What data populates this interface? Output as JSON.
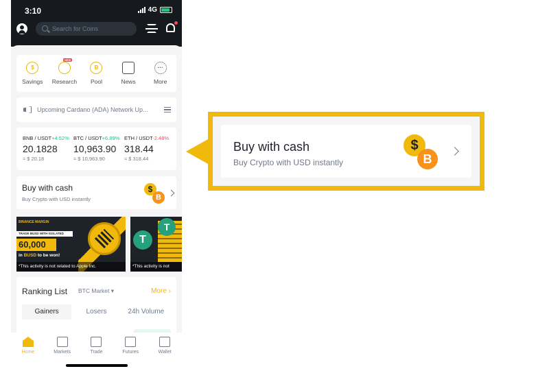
{
  "status_bar": {
    "time": "3:10",
    "network": "4G"
  },
  "header": {
    "search_placeholder": "Search for Coins"
  },
  "quick_actions": [
    {
      "label": "Savings",
      "icon": "savings-icon",
      "glyph": "$"
    },
    {
      "label": "Research",
      "icon": "research-icon",
      "glyph": "",
      "badge": "NEW"
    },
    {
      "label": "Pool",
      "icon": "pool-icon",
      "glyph": "B"
    },
    {
      "label": "News",
      "icon": "news-icon",
      "glyph": ""
    },
    {
      "label": "More",
      "icon": "more-icon",
      "glyph": "···"
    }
  ],
  "announcement": {
    "text": "Upcoming Cardano (ADA) Network Up..."
  },
  "tickers": [
    {
      "pair": "BNB / USDT",
      "change": "+4.52%",
      "direction": "up",
      "price": "20.1828",
      "usd": "≈ $ 20.18"
    },
    {
      "pair": "BTC / USDT",
      "change": "+6.89%",
      "direction": "up",
      "price": "10,963.90",
      "usd": "≈ $ 10,963.90"
    },
    {
      "pair": "ETH / USDT",
      "change": "-2.48%",
      "direction": "down",
      "price": "318.44",
      "usd": "≈ $ 318.44"
    }
  ],
  "buy_with_cash": {
    "title": "Buy with cash",
    "subtitle": "Buy Crypto with USD instantly",
    "coin_dollar": "$",
    "coin_btc": "B"
  },
  "banners": [
    {
      "brand": "BINANCE MARGIN",
      "strip": "TRADE BUSD WITH ISOLATED MARGIN",
      "amount": "60,000",
      "won_prefix": "in",
      "won_coin": "BUSD",
      "won_suffix": "to be won!",
      "disclaimer": "*This activity is not related to Apple Inc."
    },
    {
      "coin": "T",
      "disclaimer": "*This activity is not"
    }
  ],
  "ranking": {
    "title": "Ranking List",
    "market": "BTC Market ▾",
    "more": "More ›",
    "tabs": [
      "Gainers",
      "Losers",
      "24h Volume"
    ],
    "active_tab": "Gainers"
  },
  "tab_bar": {
    "items": [
      "Home",
      "Markets",
      "Trade",
      "Futures",
      "Wallet"
    ],
    "active": "Home"
  },
  "callout": {
    "title": "Buy with cash",
    "subtitle": "Buy Crypto with USD instantly"
  },
  "colors": {
    "accent": "#f0b90b",
    "up": "#0ecb81",
    "down": "#f6465d",
    "dark": "#161a1e"
  }
}
